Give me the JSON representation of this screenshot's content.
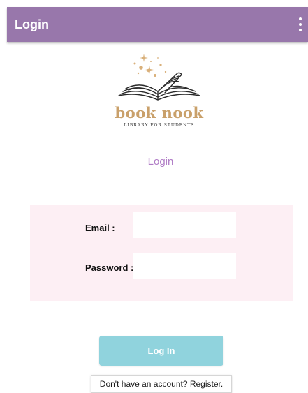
{
  "app_bar": {
    "title": "Login",
    "menu_icon": "overflow-menu-icon",
    "color": "#9877ab"
  },
  "logo": {
    "title": "book nook",
    "subtitle": "LIBRARY FOR STUDENTS",
    "icon": "open-book-icon",
    "accent": "#c9a06a"
  },
  "page": {
    "heading": "Login",
    "heading_color": "#b07cc6"
  },
  "form": {
    "email_label": "Email :",
    "email_value": "",
    "password_label": "Password :",
    "password_value": "",
    "panel_color": "#fdeff4"
  },
  "actions": {
    "login_label": "Log In",
    "login_color": "#90d3dd",
    "register_text": "Don't have an account? Register."
  }
}
